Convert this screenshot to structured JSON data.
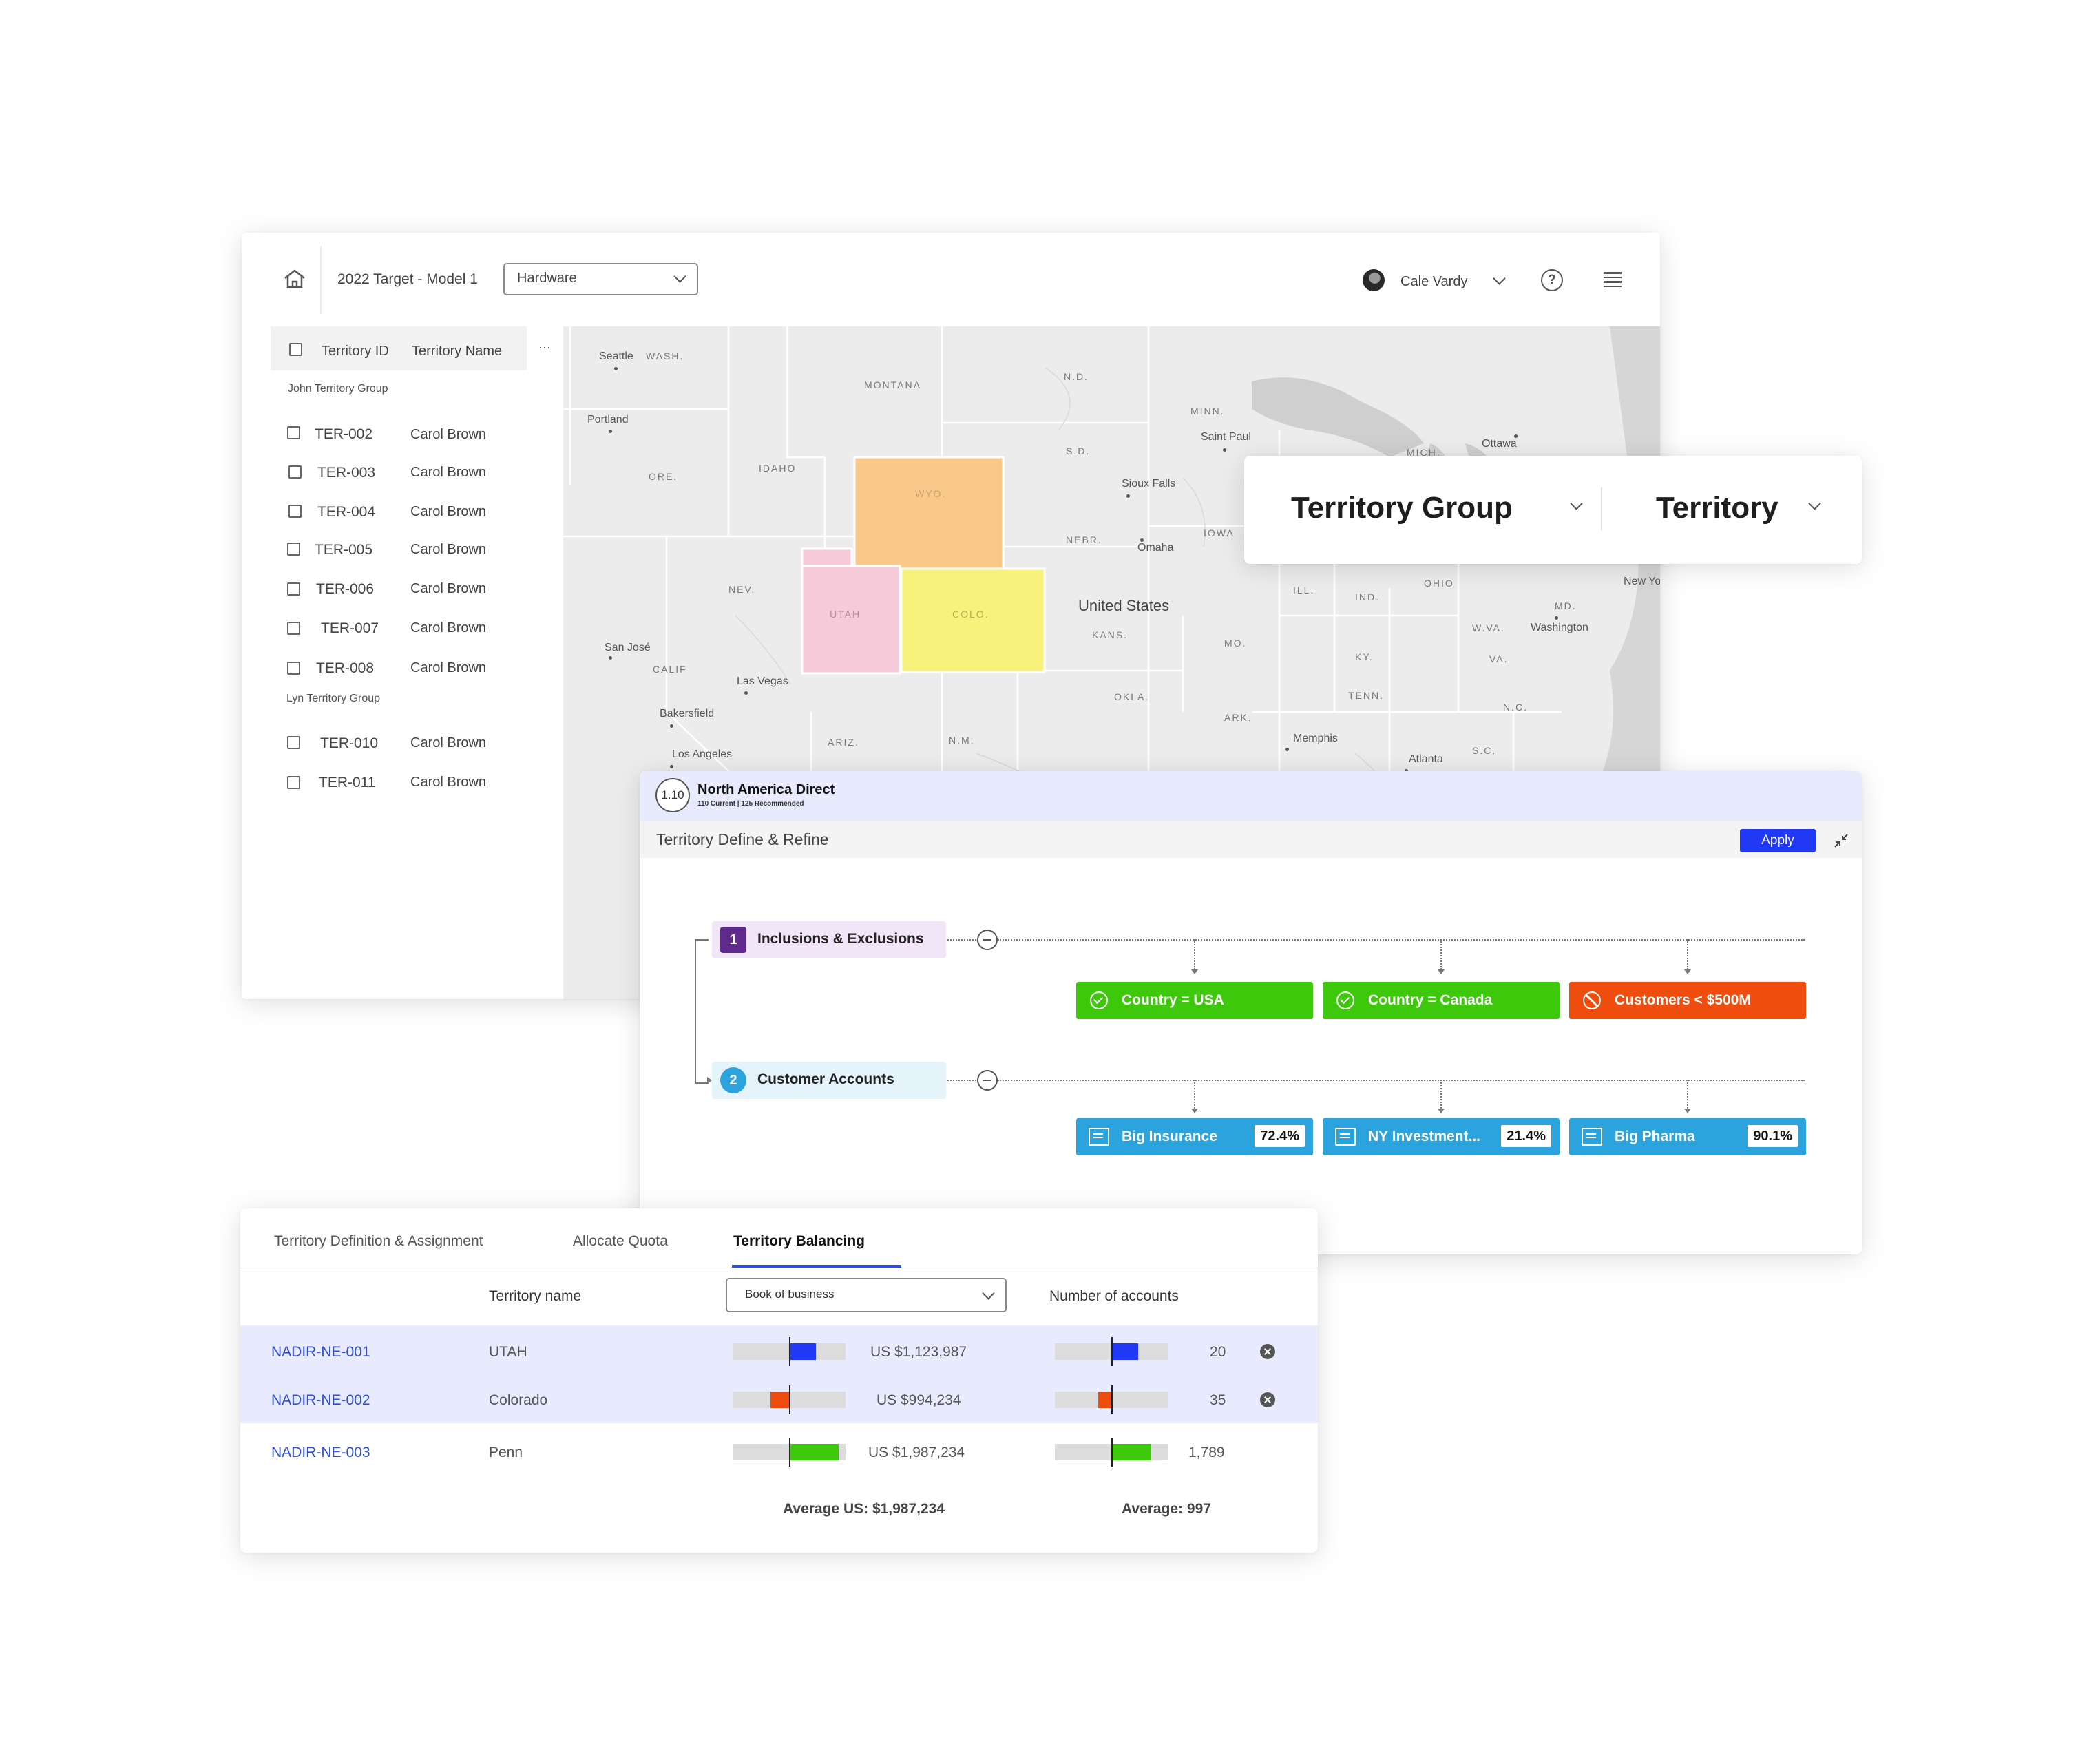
{
  "map_window": {
    "model_title": "2022 Target - Model 1",
    "product_select": "Hardware",
    "user_name": "Cale Vardy",
    "columns": {
      "id": "Territory ID",
      "name": "Territory Name",
      "more": "···"
    },
    "groups": [
      {
        "label": "John Territory Group",
        "rows": [
          {
            "id": "TER-002",
            "name": "Carol Brown"
          },
          {
            "id": "TER-003",
            "name": "Carol Brown"
          },
          {
            "id": "TER-004",
            "name": "Carol Brown"
          },
          {
            "id": "TER-005",
            "name": "Carol Brown"
          },
          {
            "id": "TER-006",
            "name": "Carol Brown"
          },
          {
            "id": "TER-007",
            "name": "Carol Brown"
          },
          {
            "id": "TER-008",
            "name": "Carol Brown"
          }
        ]
      },
      {
        "label": "Lyn Territory Group",
        "rows": [
          {
            "id": "TER-010",
            "name": "Carol Brown"
          },
          {
            "id": "TER-011",
            "name": "Carol Brown"
          }
        ]
      }
    ],
    "map": {
      "country_label": "United States",
      "state_labels": [
        "WASH.",
        "MONTANA",
        "N.D.",
        "MINN.",
        "S.D.",
        "IDAHO",
        "ORE.",
        "WYO.",
        "NEBR.",
        "IOWA",
        "NEV.",
        "UTAH",
        "COLO.",
        "KANS.",
        "ILL.",
        "IND.",
        "OHIO",
        "W.VA.",
        "VA.",
        "MD.",
        "CALIF",
        "ARIZ.",
        "N.M.",
        "OKLA.",
        "ARK.",
        "MO.",
        "KY.",
        "TENN.",
        "N.C.",
        "S.C.",
        "MICH."
      ],
      "cities": [
        "Seattle",
        "Portland",
        "Saint Paul",
        "Sioux Falls",
        "Omaha",
        "Ottawa",
        "New York",
        "Washington",
        "San José",
        "Las Vegas",
        "Bakersfield",
        "Los Angeles",
        "Memphis",
        "Atlanta"
      ],
      "region_colors": {
        "wyo": "#f9c98a",
        "utah": "#f6cad9",
        "colo": "#f8f27d"
      }
    }
  },
  "dropdowns": {
    "group_label": "Territory Group",
    "territory_label": "Territory"
  },
  "define_window": {
    "badge": "1.10",
    "title": "North America Direct",
    "stats": "110 Current | 125 Recommended",
    "subtitle": "Territory Define & Refine",
    "apply_label": "Apply",
    "steps": [
      {
        "num": "1",
        "label": "Inclusions & Exclusions",
        "color": "#5f2a8c",
        "bg": "#f0e6f8"
      },
      {
        "num": "2",
        "label": "Customer Accounts",
        "color": "#2ba3dc",
        "bg": "#e5f4fb"
      }
    ],
    "rules": [
      {
        "label": "Country = USA",
        "color": "#3ec80b"
      },
      {
        "label": "Country = Canada",
        "color": "#3ec80b"
      },
      {
        "label": "Customers < $500M",
        "color": "#ee4d0e"
      }
    ],
    "accounts": [
      {
        "label": "Big Insurance",
        "pct": "72.4%",
        "color": "#2ba3dc"
      },
      {
        "label": "NY Investment...",
        "pct": "21.4%",
        "color": "#2ba3dc"
      },
      {
        "label": "Big Pharma",
        "pct": "90.1%",
        "color": "#2ba3dc"
      }
    ]
  },
  "balance_window": {
    "tabs": [
      "Territory Definition & Assignment",
      "Allocate Quota",
      "Territory Balancing"
    ],
    "active_tab": "Territory Balancing",
    "headers": {
      "name": "Territory name",
      "metric_select": "Book of business",
      "accounts": "Number of accounts"
    },
    "rows": [
      {
        "id": "NADIR-NE-001",
        "name": "UTAH",
        "value": "US $1,123,987",
        "accounts": "20",
        "highlighted": true,
        "removable": true,
        "bob_delta": 0.23,
        "acc_delta": 0.23,
        "color": "#2138f5"
      },
      {
        "id": "NADIR-NE-002",
        "name": "Colorado",
        "value": "US $994,234",
        "accounts": "35",
        "highlighted": true,
        "removable": true,
        "bob_delta": -0.17,
        "acc_delta": -0.12,
        "color": "#ee4d0e"
      },
      {
        "id": "NADIR-NE-003",
        "name": "Penn",
        "value": "US $1,987,234",
        "accounts": "1,789",
        "highlighted": false,
        "removable": false,
        "bob_delta": 0.43,
        "acc_delta": 0.35,
        "color": "#3ec80b"
      }
    ],
    "avg_value": "Average US: $1,987,234",
    "avg_accounts": "Average: 997"
  }
}
